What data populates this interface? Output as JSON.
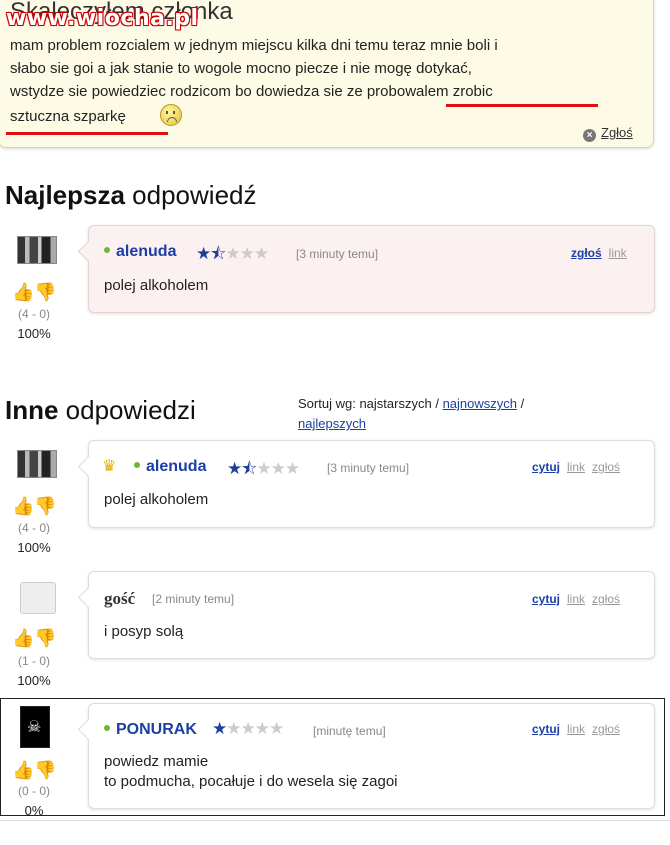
{
  "question": {
    "title": "Skaleczyłem członka",
    "watermark": "www.wiocha.pl",
    "lines": [
      "mam problem rozcialem w jednym miejscu kilka dni temu teraz mnie boli i",
      "słabo sie goi a jak stanie to wogole mocno piecze i nie mogę dotykać,",
      "wstydze sie powiedziec rodzicom bo dowiedza sie ze probowalem zrobic",
      "sztuczna szparkę"
    ],
    "report_label": "Zgłoś",
    "highlight_color": "#e01010"
  },
  "best": {
    "heading_bold": "Najlepsza",
    "heading_rest": " odpowiedź",
    "answer": {
      "user": "alenuda",
      "rating": 1.5,
      "time": "[3 minuty temu]",
      "links": [
        "zgłoś",
        "link"
      ],
      "body": [
        "polej alkoholem"
      ],
      "votes": "(4 - 0)",
      "percent": "100%"
    }
  },
  "others": {
    "heading_bold": "Inne",
    "heading_rest": " odpowiedzi",
    "sort": {
      "label": "Sortuj wg:",
      "current": "najstarszych",
      "sep": "/",
      "options": [
        "najnowszych",
        "najlepszych"
      ]
    },
    "answers": [
      {
        "user": "alenuda",
        "rating": 1.5,
        "time": "[3 minuty temu]",
        "links": [
          "cytuj",
          "link",
          "zgłoś"
        ],
        "body": [
          "polej alkoholem"
        ],
        "votes": "(4 - 0)",
        "percent": "100%"
      },
      {
        "user": "gość",
        "time": "[2 minuty temu]",
        "links": [
          "cytuj",
          "link",
          "zgłoś"
        ],
        "body": [
          "i posyp solą"
        ],
        "votes": "(1 - 0)",
        "percent": "100%"
      },
      {
        "user": "PONURAK",
        "rating": 1,
        "time": "[minutę temu]",
        "links": [
          "cytuj",
          "link",
          "zgłoś"
        ],
        "body": [
          "powiedz mamie",
          "to podmucha, pocałuje i do wesela się zagoi"
        ],
        "votes": "(0 - 0)",
        "percent": "0%"
      }
    ]
  },
  "colors": {
    "username": "#1b3fa6",
    "star_on": "#1f3f9a",
    "thumb_up": "#d86ab8",
    "thumb_down": "#e0a400",
    "online_dot": "#6bb833"
  }
}
